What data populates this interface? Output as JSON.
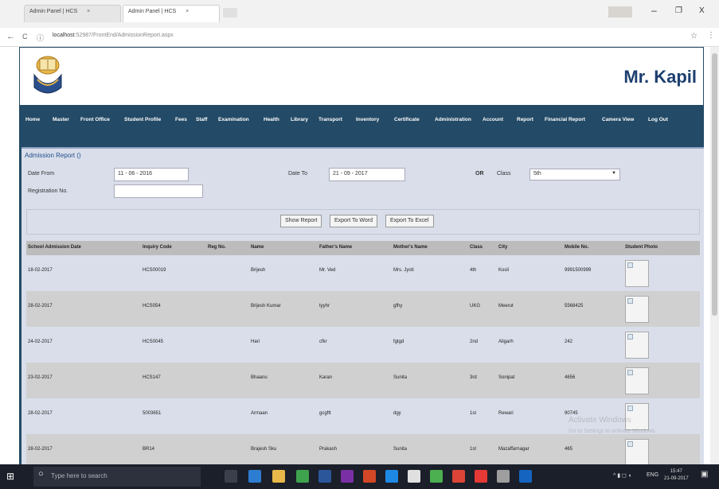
{
  "browser": {
    "tabs": [
      {
        "title": "Admin Panel | HCS",
        "close": "×"
      },
      {
        "title": "Admin Panel | HCS",
        "close": "×"
      }
    ],
    "url_host": "localhost",
    "url_path": ":52987/FrontEnd/AdmissionReport.aspx",
    "back": "←",
    "reload": "C",
    "info": "ⓘ",
    "star": "☆",
    "menu": "⋮",
    "min": "–",
    "restore": "❐",
    "close": "X"
  },
  "header": {
    "user": "Mr. Kapil"
  },
  "menu": [
    "Home",
    "Master",
    "Front Office",
    "Student Profile",
    "Fees",
    "Staff",
    "Examination",
    "Health",
    "Library",
    "Transport",
    "Inventory",
    "Certificate",
    "Administration",
    "Account",
    "Report",
    "Financial Report",
    "Camera View",
    "Log Out"
  ],
  "report": {
    "title": "Admission Report ()",
    "date_from_label": "Date From",
    "date_from_value": "11 - 06 - 2016",
    "date_to_label": "Date To",
    "date_to_value": "21 - 09 - 2017",
    "or_label": "OR",
    "class_label": "Class",
    "class_value": "5th",
    "regno_label": "Registration No.",
    "regno_value": "",
    "buttons": {
      "show": "Show Report",
      "word": "Export To Word",
      "excel": "Export To Excel"
    }
  },
  "table": {
    "headers": [
      "School Admission Date",
      "Inquiry Code",
      "Reg No.",
      "Name",
      "Father's Name",
      "Mother's Name",
      "Class",
      "City",
      "Mobile No.",
      "Student Photo"
    ],
    "rows": [
      [
        "18-02-2017",
        "HCS00019",
        "",
        "Brijesh",
        "Mr. Ved",
        "Mrs. Jyoti",
        "4th",
        "Kosli",
        "9991500999",
        ""
      ],
      [
        "28-02-2017",
        "HCS054",
        "",
        "Brijesh Kumar",
        "tyyhr",
        "gfhy",
        "UKG",
        "Meerut",
        "5568425",
        ""
      ],
      [
        "24-02-2017",
        "HCS0045",
        "",
        "Hari",
        "cfkr",
        "fgtgd",
        "2nd",
        "Aligarh",
        "242",
        ""
      ],
      [
        "23-02-2017",
        "HCS147",
        "",
        "Bhaanu",
        "Karan",
        "Sunita",
        "3rd",
        "Sonipat",
        "4656",
        ""
      ],
      [
        "28-02-2017",
        "5003651",
        "",
        "Armaan",
        "gcgftt",
        "dgy",
        "1st",
        "Rewari",
        "90745",
        ""
      ],
      [
        "28-02-2017",
        "BR14",
        "",
        "Brajesh Sku",
        "Prakash",
        "Sunita",
        "1st",
        "Mazaffarnagar",
        "465",
        ""
      ]
    ]
  },
  "watermark": [
    "Activate Windows",
    "Go to Settings to activate Windows."
  ],
  "taskbar": {
    "search_placeholder": "Type here to search",
    "clock_time": "15:47",
    "clock_date": "21-09-2017",
    "lang": "ENG"
  }
}
